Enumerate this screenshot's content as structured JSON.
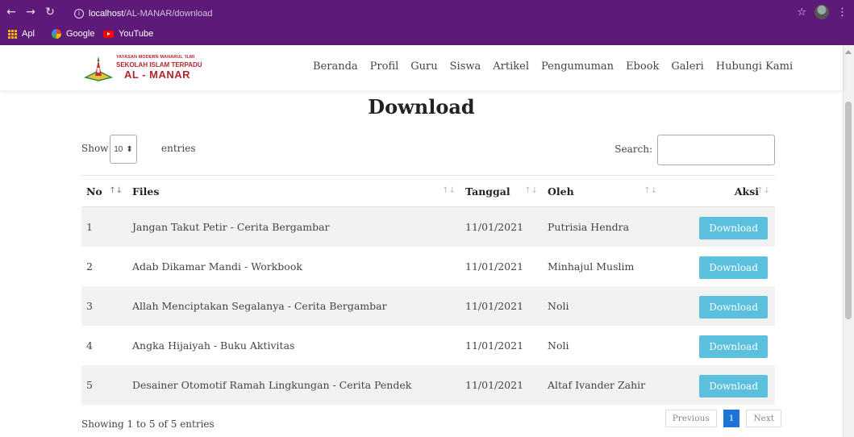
{
  "browser": {
    "url_host": "localhost",
    "url_path": "/AL-MANAR/download",
    "bookmarks": [
      {
        "label": "Apl"
      },
      {
        "label": "Google"
      },
      {
        "label": "YouTube"
      }
    ]
  },
  "logo": {
    "line1": "YAYASAN MODERN MANARUL 'ILMI",
    "line2": "SEKOLAH ISLAM TERPADU",
    "line3": "AL - MANAR"
  },
  "menu": [
    "Beranda",
    "Profil",
    "Guru",
    "Siswa",
    "Artikel",
    "Pengumuman",
    "Ebook",
    "Galeri",
    "Hubungi Kami"
  ],
  "page_title": "Download",
  "controls": {
    "show_label": "Show",
    "length_value": "10",
    "entries_label": "entries",
    "search_label": "Search:",
    "search_value": ""
  },
  "table": {
    "headers": {
      "no": "No",
      "files": "Files",
      "tanggal": "Tanggal",
      "oleh": "Oleh",
      "aksi": "Aksi"
    },
    "rows": [
      {
        "no": "1",
        "file": "Jangan Takut Petir - Cerita Bergambar",
        "tanggal": "11/01/2021",
        "oleh": "Putrisia Hendra",
        "action": "Download"
      },
      {
        "no": "2",
        "file": "Adab Dikamar Mandi - Workbook",
        "tanggal": "11/01/2021",
        "oleh": "Minhajul Muslim",
        "action": "Download"
      },
      {
        "no": "3",
        "file": "Allah Menciptakan Segalanya - Cerita Bergambar",
        "tanggal": "11/01/2021",
        "oleh": "Noli",
        "action": "Download"
      },
      {
        "no": "4",
        "file": "Angka Hijaiyah - Buku Aktivitas",
        "tanggal": "11/01/2021",
        "oleh": "Noli",
        "action": "Download"
      },
      {
        "no": "5",
        "file": "Desainer Otomotif Ramah Lingkungan - Cerita Pendek",
        "tanggal": "11/01/2021",
        "oleh": "Altaf Ivander Zahir",
        "action": "Download"
      }
    ]
  },
  "footer": {
    "info": "Showing 1 to 5 of 5 entries",
    "previous": "Previous",
    "current_page": "1",
    "next": "Next"
  },
  "colors": {
    "browser_frame": "#5e1a78",
    "download_button": "#5bc0de",
    "current_page": "#1e73d8",
    "logo_red": "#b3262e"
  }
}
